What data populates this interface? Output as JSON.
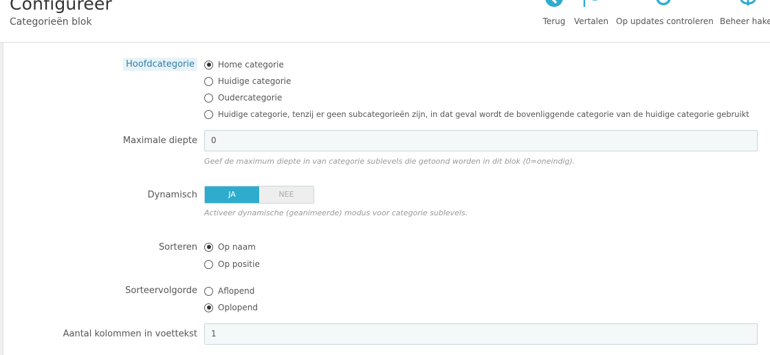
{
  "header": {
    "title": "Configureer",
    "subtitle": "Categorieën blok",
    "accent_color": "#2eacce",
    "toolbar": [
      {
        "label": "Terug",
        "icon": "back-arrow-icon"
      },
      {
        "label": "Vertalen",
        "icon": "flag-icon"
      },
      {
        "label": "Op updates controleren",
        "icon": "refresh-icon"
      },
      {
        "label": "Beheer haken",
        "icon": "anchor-icon"
      }
    ]
  },
  "form": {
    "hoofdcategorie": {
      "label": "Hoofdcategorie",
      "options": [
        {
          "text": "Home categorie",
          "checked": true
        },
        {
          "text": "Huidige categorie",
          "checked": false
        },
        {
          "text": "Oudercategorie",
          "checked": false
        },
        {
          "text": "Huidige categorie, tenzij er geen subcategorieën zijn, in dat geval wordt de bovenliggende categorie van de huidige categorie gebruikt",
          "checked": false
        }
      ]
    },
    "max_depth": {
      "label": "Maximale diepte",
      "value": "0",
      "help": "Geef de maximum diepte in van categorie sublevels die getoond worden in dit blok (0=oneindig)."
    },
    "dynamic": {
      "label": "Dynamisch",
      "yes": "JA",
      "no": "NEE",
      "selected": "JA",
      "help": "Activeer dynamische (geanimeerde) modus voor categorie sublevels."
    },
    "sort": {
      "label": "Sorteren",
      "options": [
        {
          "text": "Op naam",
          "checked": true
        },
        {
          "text": "Op positie",
          "checked": false
        }
      ]
    },
    "sort_order": {
      "label": "Sorteervolgorde",
      "options": [
        {
          "text": "Aflopend",
          "checked": false
        },
        {
          "text": "Oplopend",
          "checked": true
        }
      ]
    },
    "footer_columns": {
      "label": "Aantal kolommen in voettekst",
      "value": "1"
    }
  }
}
